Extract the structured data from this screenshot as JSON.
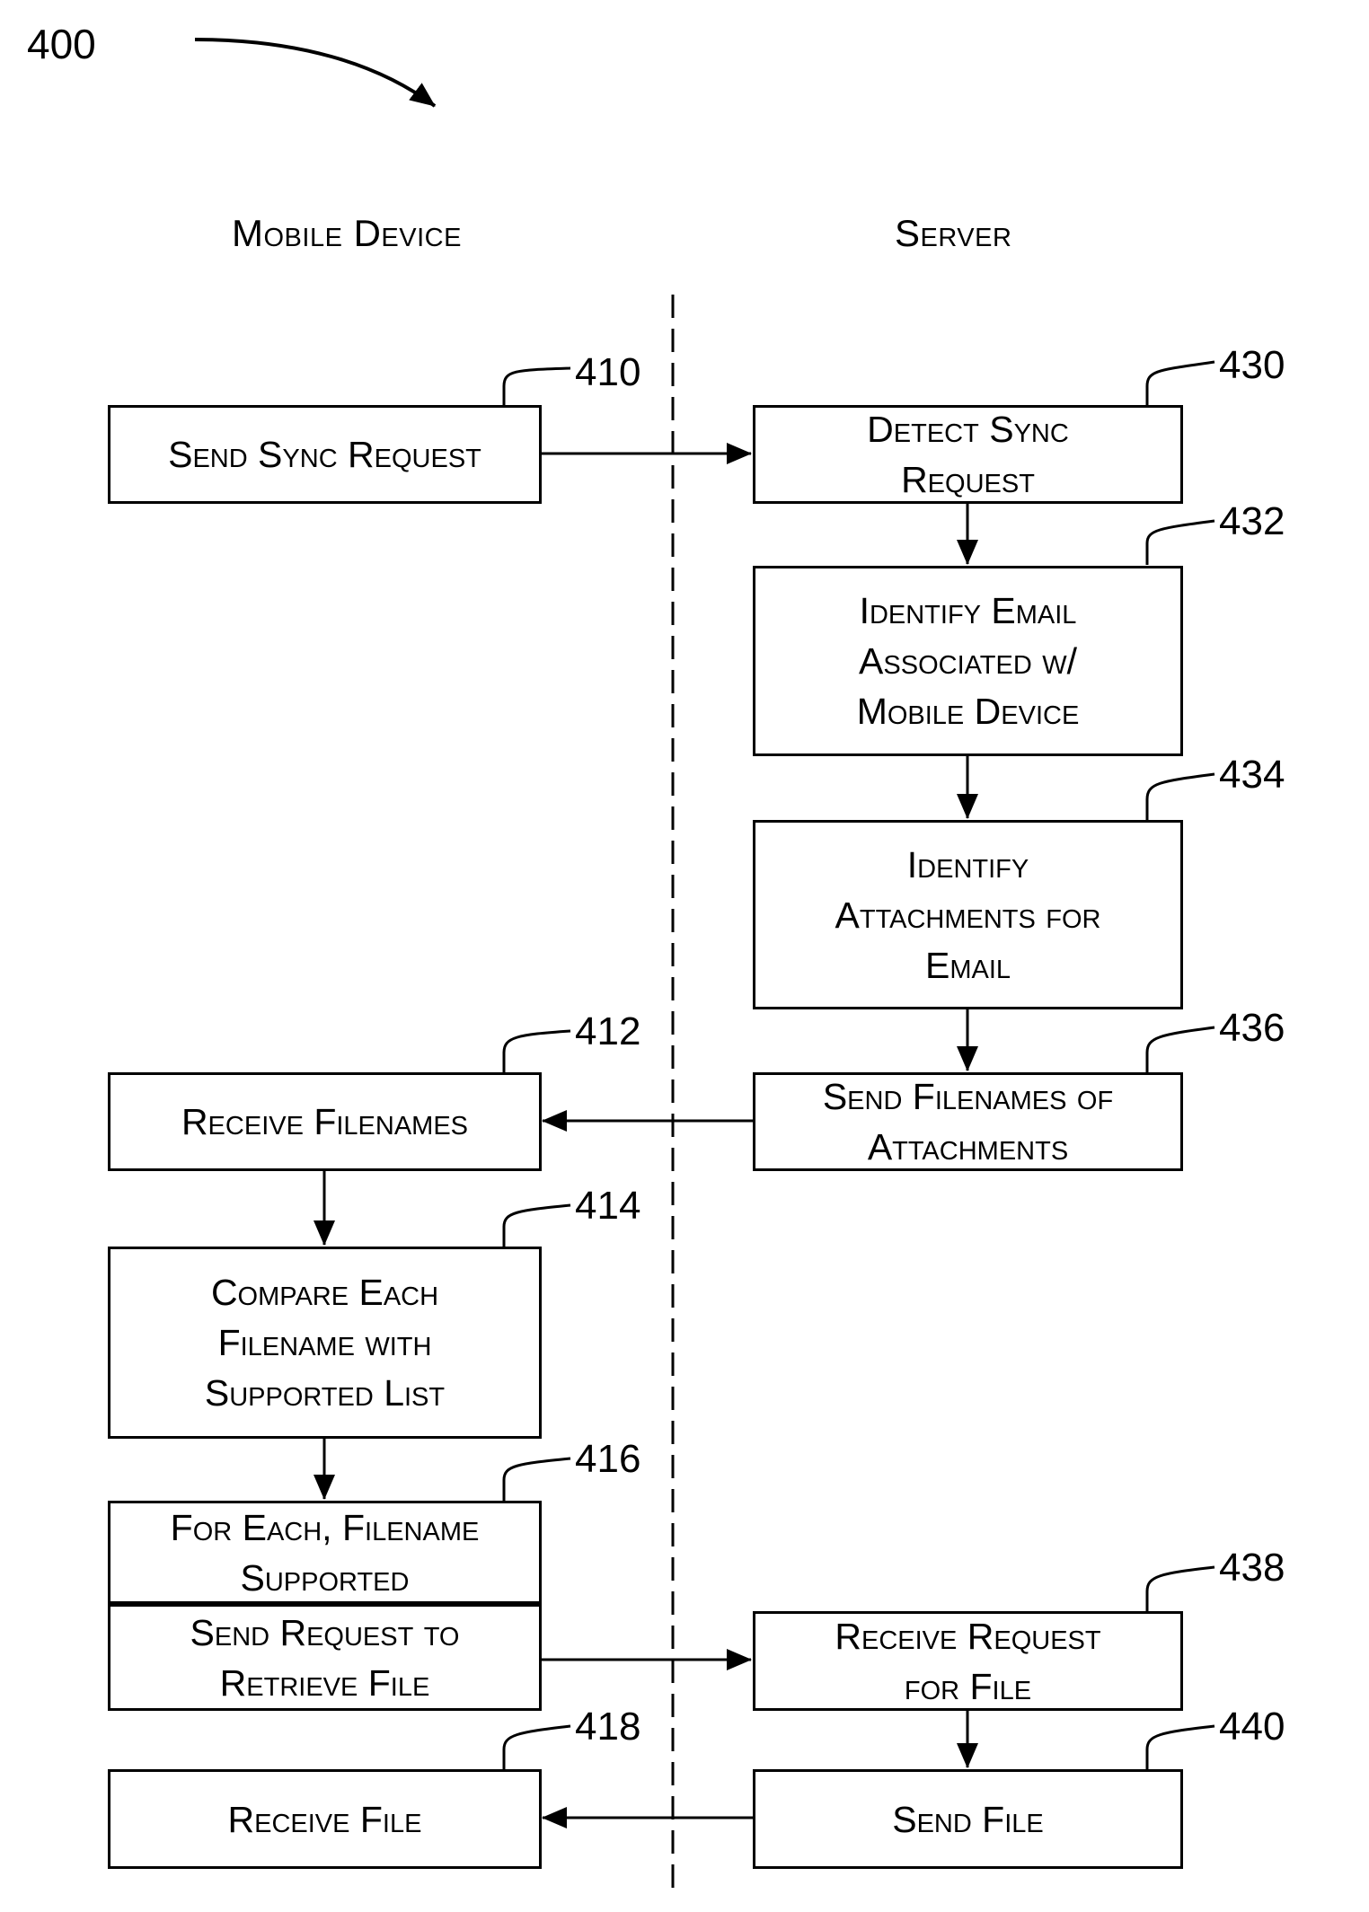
{
  "figure": {
    "number": "400"
  },
  "lanes": {
    "left": "Mobile Device",
    "right": "Server"
  },
  "steps": {
    "s410": {
      "ref": "410",
      "lines": [
        "Send Sync Request"
      ]
    },
    "s430": {
      "ref": "430",
      "lines": [
        "Detect Sync",
        "Request"
      ]
    },
    "s432": {
      "ref": "432",
      "lines": [
        "Identify Email",
        "Associated w/",
        "Mobile Device"
      ]
    },
    "s434": {
      "ref": "434",
      "lines": [
        "Identify",
        "Attachments for",
        "Email"
      ]
    },
    "s436": {
      "ref": "436",
      "lines": [
        "Send Filenames of",
        "Attachments"
      ]
    },
    "s412": {
      "ref": "412",
      "lines": [
        "Receive Filenames"
      ]
    },
    "s414": {
      "ref": "414",
      "lines": [
        "Compare Each",
        "Filename with",
        "Supported List"
      ]
    },
    "s416": {
      "ref": "416",
      "condition_lines": [
        "For Each, Filename",
        "Supported"
      ],
      "action_lines": [
        "Send Request to",
        "Retrieve File"
      ]
    },
    "s438": {
      "ref": "438",
      "lines": [
        "Receive Request",
        "for File"
      ]
    },
    "s440": {
      "ref": "440",
      "lines": [
        "Send File"
      ]
    },
    "s418": {
      "ref": "418",
      "lines": [
        "Receive File"
      ]
    }
  },
  "flows": [
    {
      "from": "410",
      "to": "430"
    },
    {
      "from": "430",
      "to": "432"
    },
    {
      "from": "432",
      "to": "434"
    },
    {
      "from": "434",
      "to": "436"
    },
    {
      "from": "436",
      "to": "412"
    },
    {
      "from": "412",
      "to": "414"
    },
    {
      "from": "414",
      "to": "416"
    },
    {
      "from": "416",
      "to": "438"
    },
    {
      "from": "438",
      "to": "440"
    },
    {
      "from": "440",
      "to": "418"
    }
  ]
}
